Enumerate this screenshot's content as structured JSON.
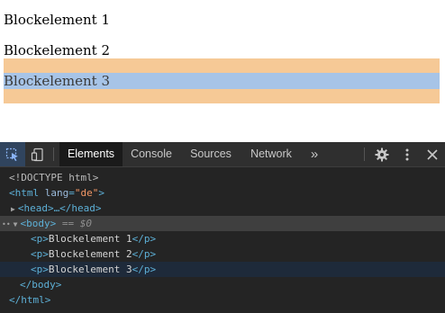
{
  "page": {
    "paragraphs": [
      "Blockelement 1",
      "Blockelement 2",
      "Blockelement 3"
    ]
  },
  "devtools": {
    "tabs": [
      {
        "label": "Elements",
        "active": true
      },
      {
        "label": "Console",
        "active": false
      },
      {
        "label": "Sources",
        "active": false
      },
      {
        "label": "Network",
        "active": false
      }
    ],
    "more_tabs": "»",
    "tree": {
      "doctype": "<!DOCTYPE html>",
      "html_open": "<html",
      "lang_attr": "lang",
      "lang_val": "\"de\"",
      "html_close_bracket": ">",
      "head_collapsed": "<head>…</head>",
      "body_open": "<body>",
      "selected_marker": "== $0",
      "p_open": "<p>",
      "p_close": "</p>",
      "p_texts": [
        "Blockelement 1",
        "Blockelement 2",
        "Blockelement 3"
      ],
      "body_close": "</body>",
      "html_close": "</html>"
    }
  },
  "colors": {
    "margin_highlight": "#f6c996",
    "content_highlight": "#a7c4e7",
    "devtools_bg": "#242424",
    "tag_color": "#5db0d7",
    "attr_value_color": "#f29766"
  }
}
